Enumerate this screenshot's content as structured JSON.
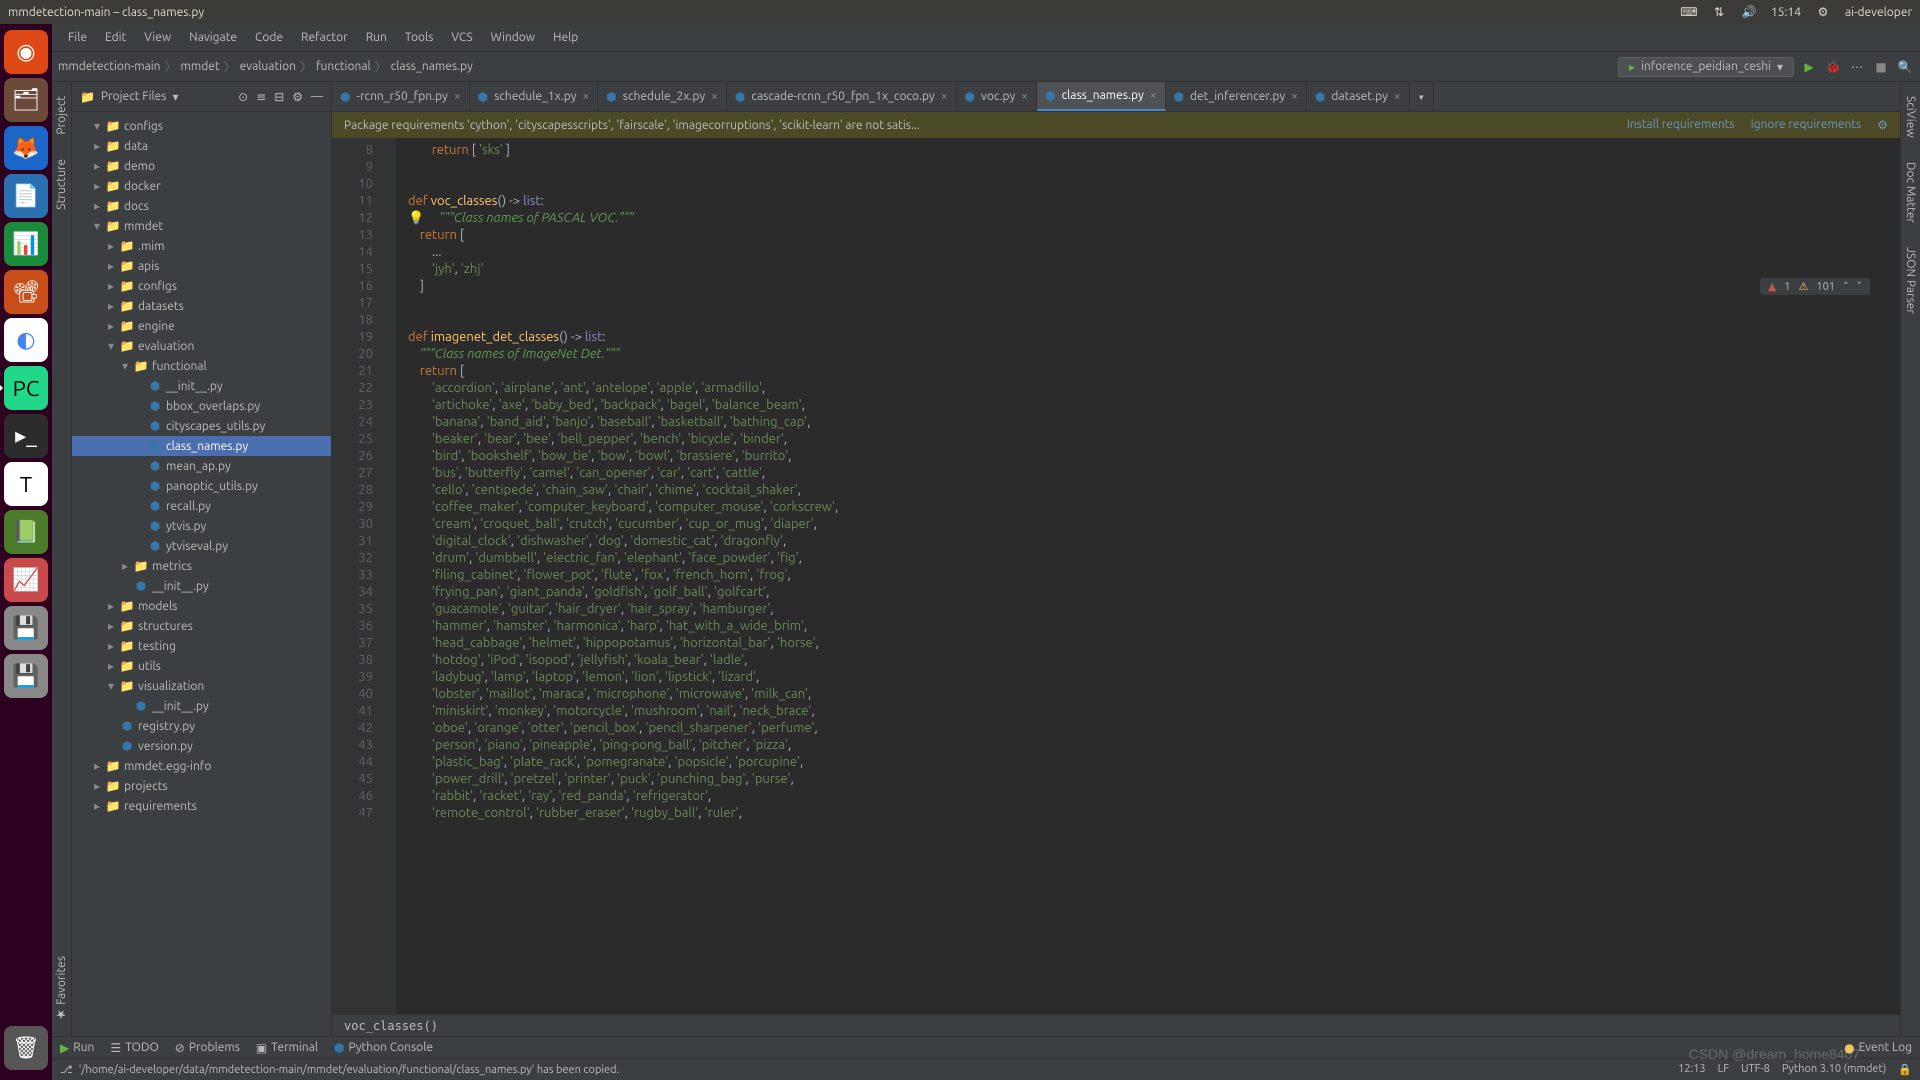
{
  "window": {
    "title": "mmdetection-main – class_names.py"
  },
  "system_tray": {
    "time": "15:14",
    "user": "ai-developer"
  },
  "menubar": [
    "File",
    "Edit",
    "View",
    "Navigate",
    "Code",
    "Refactor",
    "Run",
    "Tools",
    "VCS",
    "Window",
    "Help"
  ],
  "breadcrumb": [
    "mmdetection-main",
    "mmdet",
    "evaluation",
    "functional",
    "class_names.py"
  ],
  "run_config": "inforence_peidian_ceshi",
  "project_heading": "Project Files",
  "tree": [
    {
      "d": 1,
      "a": "▾",
      "t": "dir",
      "l": "configs"
    },
    {
      "d": 1,
      "a": "▸",
      "t": "dir",
      "l": "data"
    },
    {
      "d": 1,
      "a": "▸",
      "t": "dir",
      "l": "demo"
    },
    {
      "d": 1,
      "a": "▸",
      "t": "dir",
      "l": "docker"
    },
    {
      "d": 1,
      "a": "▸",
      "t": "dir",
      "l": "docs"
    },
    {
      "d": 1,
      "a": "▾",
      "t": "dir",
      "l": "mmdet"
    },
    {
      "d": 2,
      "a": "▸",
      "t": "dir",
      "l": ".mim"
    },
    {
      "d": 2,
      "a": "▸",
      "t": "dir",
      "l": "apis"
    },
    {
      "d": 2,
      "a": "▸",
      "t": "dir",
      "l": "configs"
    },
    {
      "d": 2,
      "a": "▸",
      "t": "dir",
      "l": "datasets"
    },
    {
      "d": 2,
      "a": "▸",
      "t": "dir",
      "l": "engine"
    },
    {
      "d": 2,
      "a": "▾",
      "t": "dir",
      "l": "evaluation"
    },
    {
      "d": 3,
      "a": "▾",
      "t": "dir",
      "l": "functional"
    },
    {
      "d": 4,
      "a": "",
      "t": "py",
      "l": "__init__.py"
    },
    {
      "d": 4,
      "a": "",
      "t": "py",
      "l": "bbox_overlaps.py"
    },
    {
      "d": 4,
      "a": "",
      "t": "py",
      "l": "cityscapes_utils.py"
    },
    {
      "d": 4,
      "a": "",
      "t": "py",
      "l": "class_names.py",
      "sel": true
    },
    {
      "d": 4,
      "a": "",
      "t": "py",
      "l": "mean_ap.py"
    },
    {
      "d": 4,
      "a": "",
      "t": "py",
      "l": "panoptic_utils.py"
    },
    {
      "d": 4,
      "a": "",
      "t": "py",
      "l": "recall.py"
    },
    {
      "d": 4,
      "a": "",
      "t": "py",
      "l": "ytvis.py"
    },
    {
      "d": 4,
      "a": "",
      "t": "py",
      "l": "ytviseval.py"
    },
    {
      "d": 3,
      "a": "▸",
      "t": "dir",
      "l": "metrics"
    },
    {
      "d": 3,
      "a": "",
      "t": "py",
      "l": "__init__.py"
    },
    {
      "d": 2,
      "a": "▸",
      "t": "dir",
      "l": "models"
    },
    {
      "d": 2,
      "a": "▸",
      "t": "dir",
      "l": "structures"
    },
    {
      "d": 2,
      "a": "▸",
      "t": "dir",
      "l": "testing"
    },
    {
      "d": 2,
      "a": "▸",
      "t": "dir",
      "l": "utils"
    },
    {
      "d": 2,
      "a": "▾",
      "t": "dir",
      "l": "visualization"
    },
    {
      "d": 3,
      "a": "",
      "t": "py",
      "l": "__init__.py"
    },
    {
      "d": 2,
      "a": "",
      "t": "py",
      "l": "registry.py"
    },
    {
      "d": 2,
      "a": "",
      "t": "py",
      "l": "version.py"
    },
    {
      "d": 1,
      "a": "▸",
      "t": "dir",
      "l": "mmdet.egg-info"
    },
    {
      "d": 1,
      "a": "▸",
      "t": "dir",
      "l": "projects"
    },
    {
      "d": 1,
      "a": "▸",
      "t": "dir",
      "l": "requirements"
    }
  ],
  "tabs": [
    {
      "l": "-rcnn_r50_fpn.py"
    },
    {
      "l": "schedule_1x.py"
    },
    {
      "l": "schedule_2x.py"
    },
    {
      "l": "cascade-rcnn_r50_fpn_1x_coco.py"
    },
    {
      "l": "voc.py"
    },
    {
      "l": "class_names.py",
      "active": true
    },
    {
      "l": "det_inferencer.py"
    },
    {
      "l": "dataset.py"
    }
  ],
  "notification": {
    "text": "Package requirements 'cython', 'cityscapesscripts', 'fairscale', 'imagecorruptions', 'scikit-learn' are not satis...",
    "install": "Install requirements",
    "ignore": "Ignore requirements"
  },
  "inspection": {
    "errors": "1",
    "warnings": "101"
  },
  "first_lineno": 8,
  "code_lines": [
    "        return [ 'sks' ]",
    "",
    "",
    "def voc_classes() -> list:",
    "    \"\"\"Class names of PASCAL VOC.\"\"\"",
    "    return [",
    "        ...",
    "        'jyh', 'zhj'",
    "    ]",
    "",
    "",
    "def imagenet_det_classes() -> list:",
    "    \"\"\"Class names of ImageNet Det.\"\"\"",
    "    return [",
    "        'accordion', 'airplane', 'ant', 'antelope', 'apple', 'armadillo',",
    "        'artichoke', 'axe', 'baby_bed', 'backpack', 'bagel', 'balance_beam',",
    "        'banana', 'band_aid', 'banjo', 'baseball', 'basketball', 'bathing_cap',",
    "        'beaker', 'bear', 'bee', 'bell_pepper', 'bench', 'bicycle', 'binder',",
    "        'bird', 'bookshelf', 'bow_tie', 'bow', 'bowl', 'brassiere', 'burrito',",
    "        'bus', 'butterfly', 'camel', 'can_opener', 'car', 'cart', 'cattle',",
    "        'cello', 'centipede', 'chain_saw', 'chair', 'chime', 'cocktail_shaker',",
    "        'coffee_maker', 'computer_keyboard', 'computer_mouse', 'corkscrew',",
    "        'cream', 'croquet_ball', 'crutch', 'cucumber', 'cup_or_mug', 'diaper',",
    "        'digital_clock', 'dishwasher', 'dog', 'domestic_cat', 'dragonfly',",
    "        'drum', 'dumbbell', 'electric_fan', 'elephant', 'face_powder', 'fig',",
    "        'filing_cabinet', 'flower_pot', 'flute', 'fox', 'french_horn', 'frog',",
    "        'frying_pan', 'giant_panda', 'goldfish', 'golf_ball', 'golfcart',",
    "        'guacamole', 'guitar', 'hair_dryer', 'hair_spray', 'hamburger',",
    "        'hammer', 'hamster', 'harmonica', 'harp', 'hat_with_a_wide_brim',",
    "        'head_cabbage', 'helmet', 'hippopotamus', 'horizontal_bar', 'horse',",
    "        'hotdog', 'iPod', 'isopod', 'jellyfish', 'koala_bear', 'ladle',",
    "        'ladybug', 'lamp', 'laptop', 'lemon', 'lion', 'lipstick', 'lizard',",
    "        'lobster', 'maillot', 'maraca', 'microphone', 'microwave', 'milk_can',",
    "        'miniskirt', 'monkey', 'motorcycle', 'mushroom', 'nail', 'neck_brace',",
    "        'oboe', 'orange', 'otter', 'pencil_box', 'pencil_sharpener', 'perfume',",
    "        'person', 'piano', 'pineapple', 'ping-pong_ball', 'pitcher', 'pizza',",
    "        'plastic_bag', 'plate_rack', 'pomegranate', 'popsicle', 'porcupine',",
    "        'power_drill', 'pretzel', 'printer', 'puck', 'punching_bag', 'purse',",
    "        'rabbit', 'racket', 'ray', 'red_panda', 'refrigerator',",
    "        'remote_control', 'rubber_eraser', 'rugby_ball', 'ruler',"
  ],
  "editor_breadcrumb": "voc_classes()",
  "bottom_tabs": {
    "run": "Run",
    "todo": "TODO",
    "problems": "Problems",
    "terminal": "Terminal",
    "pyconsole": "Python Console",
    "event": "Event Log"
  },
  "status": {
    "msg": "'/home/ai-developer/data/mmdetection-main/mmdet/evaluation/functional/class_names.py' has been copied.",
    "pos": "12:13",
    "sep": "LF",
    "enc": "UTF-8",
    "interp": "Python 3.10 (mmdet)"
  },
  "left_tabs": [
    "Project",
    "Structure",
    "Favorites"
  ],
  "right_tabs": [
    "SciView",
    "Doc Matter",
    "JSON Parser"
  ],
  "watermark": "CSDN @dream_home8407"
}
